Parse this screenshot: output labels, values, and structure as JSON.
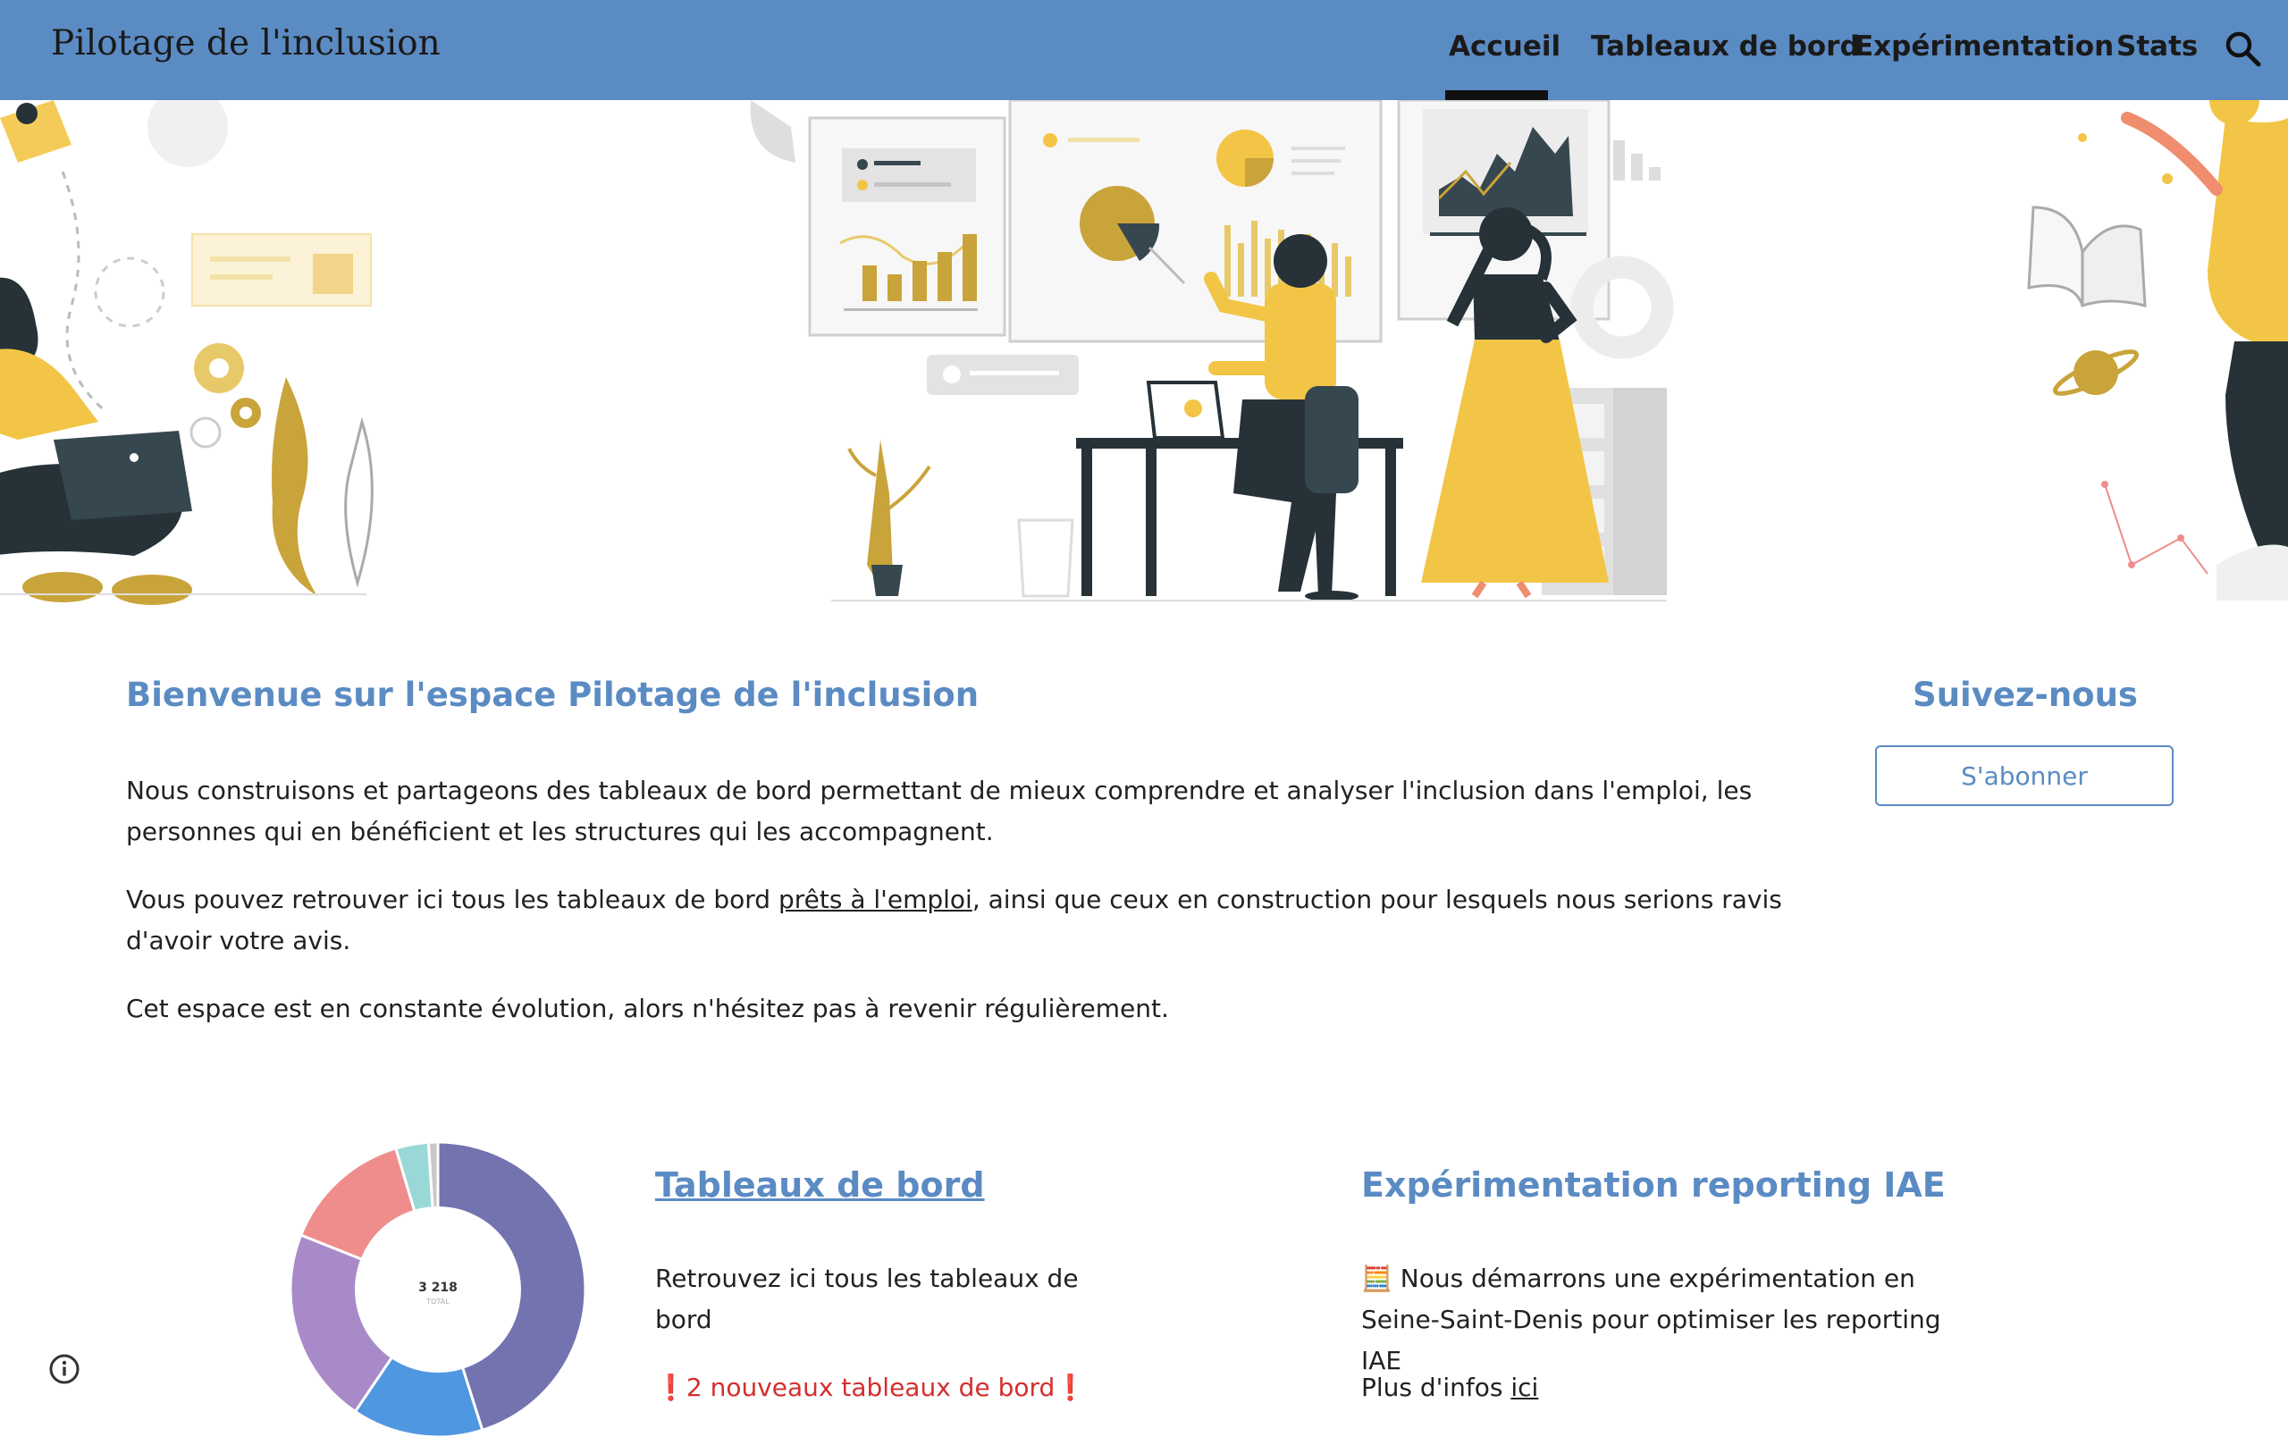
{
  "header": {
    "site_title": "Pilotage de l'inclusion",
    "nav": [
      {
        "label": "Accueil",
        "active": true
      },
      {
        "label": "Tableaux de bord",
        "active": false
      },
      {
        "label": "Expérimentation",
        "active": false
      },
      {
        "label": "Stats",
        "active": false
      }
    ],
    "search_icon": "search-icon",
    "accent_color": "#5b8bc3"
  },
  "main": {
    "welcome_title": "Bienvenue sur l'espace Pilotage de l'inclusion",
    "p1": "Nous construisons et partageons des tableaux de bord permettant de mieux comprendre et analyser l'inclusion dans l'emploi, les personnes qui en bénéficient et les structures qui les accompagnent.",
    "p2_before": "Vous pouvez retrouver ici tous les tableaux de bord ",
    "p2_link": "prêts à l'emploi",
    "p2_after": ", ainsi que ceux en construction pour lesquels nous serions ravis d'avoir votre avis.",
    "p3": "Cet espace est en constante évolution, alors n'hésitez pas à revenir régulièrement."
  },
  "follow": {
    "title": "Suivez-nous",
    "subscribe_label": "S'abonner"
  },
  "cards": {
    "dashboards": {
      "title": "Tableaux de bord",
      "text": "Retrouvez ici tous les tableaux de bord",
      "alert": "❗2 nouveaux tableaux de bord❗"
    },
    "experiment": {
      "title": "Expérimentation reporting IAE",
      "text": "🧮 Nous démarrons une expérimentation en Seine-Saint-Denis pour optimiser les reporting IAE",
      "more_before": "Plus d'infos ",
      "more_link": "ici"
    }
  },
  "donut": {
    "total": "3 218",
    "total_label": "TOTAL",
    "slices": [
      {
        "value": 44,
        "color": "#7373b0"
      },
      {
        "value": 14,
        "color": "#4f97e0"
      },
      {
        "value": 21,
        "color": "#a98ac9"
      },
      {
        "value": 14,
        "color": "#ef8d8d"
      },
      {
        "value": 3.5,
        "color": "#9ad8d8"
      },
      {
        "value": 1,
        "color": "#c9c9c9"
      }
    ]
  },
  "footer": {
    "info_icon": "info-icon"
  }
}
